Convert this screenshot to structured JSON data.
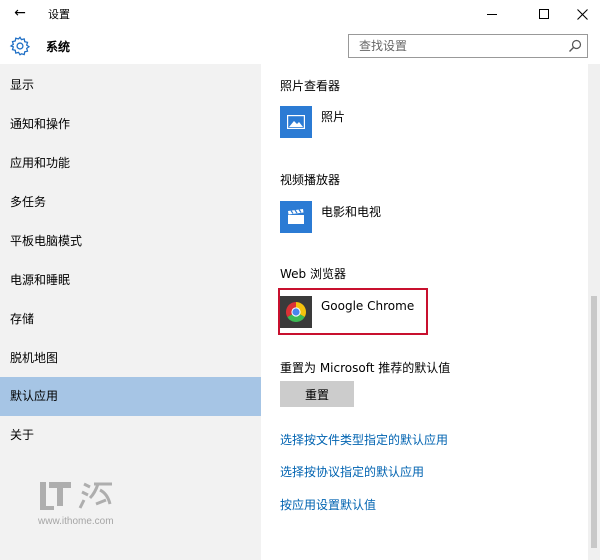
{
  "window": {
    "title": "设置",
    "back_glyph": "←"
  },
  "header": {
    "section_title": "系统",
    "search_placeholder": "查找设置"
  },
  "sidebar": {
    "items": [
      {
        "label": "显示"
      },
      {
        "label": "通知和操作"
      },
      {
        "label": "应用和功能"
      },
      {
        "label": "多任务"
      },
      {
        "label": "平板电脑模式"
      },
      {
        "label": "电源和睡眠"
      },
      {
        "label": "存储"
      },
      {
        "label": "脱机地图"
      },
      {
        "label": "默认应用",
        "active": true
      },
      {
        "label": "关于"
      }
    ]
  },
  "content": {
    "groups": [
      {
        "title": "照片查看器",
        "app_name": "照片",
        "icon": "photos-icon"
      },
      {
        "title": "视频播放器",
        "app_name": "电影和电视",
        "icon": "movies-tv-icon"
      },
      {
        "title": "Web 浏览器",
        "app_name": "Google Chrome",
        "icon": "chrome-icon"
      }
    ],
    "reset_heading": "重置为 Microsoft 推荐的默认值",
    "reset_button": "重置",
    "links": [
      "选择按文件类型指定的默认应用",
      "选择按协议指定的默认应用",
      "按应用设置默认值"
    ]
  },
  "watermark": {
    "logo_text": "IT之家",
    "url": "www.ithome.com"
  },
  "colors": {
    "accent_tile": "#2b7bd4",
    "active_nav": "#a6c5e5",
    "link": "#0063b1",
    "highlight_border": "#c8102e",
    "sidebar_bg": "#f2f2f2"
  }
}
